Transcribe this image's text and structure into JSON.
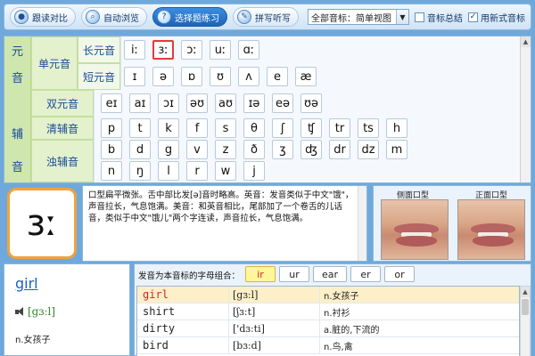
{
  "toolbar": {
    "buttons": [
      {
        "label": "跟读对比",
        "icon": "record-icon"
      },
      {
        "label": "自动浏览",
        "icon": "magnifier-icon"
      },
      {
        "label": "选择题练习",
        "icon": "quiz-icon"
      },
      {
        "label": "拼写听写",
        "icon": "pen-icon"
      }
    ],
    "select_value": "全部音标：简单视图",
    "chk_summary": "音标总结",
    "chk_new": "用新式音标"
  },
  "table": {
    "vowel_char1": "元",
    "vowel_char2": "音",
    "cons_char1": "辅",
    "cons_char2": "音",
    "monophthong": "单元音",
    "long_vowel": "长元音",
    "short_vowel": "短元音",
    "diphthong": "双元音",
    "voiceless": "清辅音",
    "voiced": "浊辅音",
    "long": [
      "iː",
      "ɜː",
      "ɔː",
      "uː",
      "ɑː"
    ],
    "short": [
      "ɪ",
      "ə",
      "ɒ",
      "ʊ",
      "ʌ",
      "e",
      "æ"
    ],
    "diph": [
      "eɪ",
      "aɪ",
      "ɔɪ",
      "əʊ",
      "aʊ",
      "ɪə",
      "eə",
      "ʊə"
    ],
    "voiceless_list": [
      "p",
      "t",
      "k",
      "f",
      "s",
      "θ",
      "ʃ",
      "ʧ",
      "tr",
      "ts",
      "h"
    ],
    "voiced_row1": [
      "b",
      "d",
      "g",
      "v",
      "z",
      "ð",
      "ʒ",
      "ʤ",
      "dr",
      "dz",
      "m"
    ],
    "voiced_row2": [
      "n",
      "ŋ",
      "l",
      "r",
      "w",
      "j"
    ]
  },
  "current": {
    "symbol": "ɜː",
    "description": "口型扁平微张。舌中部比发[ə]音时略高。英音：发音类似于中文\"饿\"，声音拉长，气息饱满。美音：和英音相比，尾部加了一个卷舌的儿话音，类似于中文\"饿儿\"两个字连读，声音拉长，气息饱满。",
    "side_label": "侧面口型",
    "front_label": "正面口型"
  },
  "word": {
    "text": "girl",
    "phonetic": "[gɜːl]",
    "meaning": "n.女孩子"
  },
  "combos": {
    "label": "发音为本音标的字母组合：",
    "items": [
      "ir",
      "ur",
      "ear",
      "er",
      "or"
    ]
  },
  "examples": [
    {
      "word": "girl",
      "ipa": "[gɜːl]",
      "meaning": "n.女孩子"
    },
    {
      "word": "shirt",
      "ipa": "[ʃɜːt]",
      "meaning": "n.衬衫"
    },
    {
      "word": "dirty",
      "ipa": "['dɜːti]",
      "meaning": "a.脏的,下流的"
    },
    {
      "word": "bird",
      "ipa": "[bɜːd]",
      "meaning": "n.鸟,禽"
    }
  ]
}
